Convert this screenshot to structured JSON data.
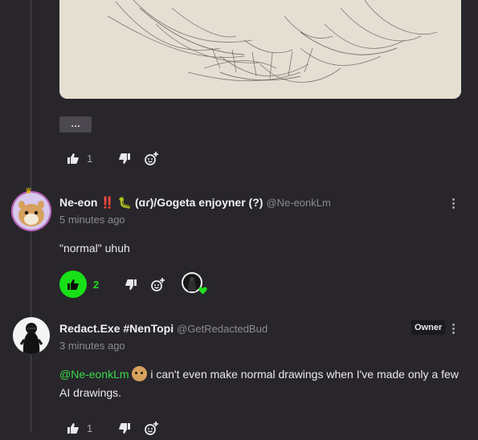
{
  "post": {
    "more_chip": "…",
    "like_count": "1"
  },
  "comments": [
    {
      "name": "Ne-eon ‼️ 🐛 (ɑɾ)/Gogeta enjoyner (?)",
      "handle": "@Ne-eonkLm",
      "time": "5 minutes ago",
      "text": "\"normal\" uhuh",
      "like_count": "2",
      "liked": true
    },
    {
      "name": "Redact.Exe #NenTopi",
      "handle": "@GetRedactedBud",
      "time": "3 minutes ago",
      "badge": "Owner",
      "mention": "@Ne-eonkLm",
      "text": " i can't even make normal drawings when I've made only a few AI drawings.",
      "like_count": "1"
    }
  ],
  "colors": {
    "background": "#28262b",
    "liked": "#17e017",
    "mention": "#39d94a"
  },
  "icons": [
    "thumbs-up-icon",
    "thumbs-down-icon",
    "add-reaction-icon",
    "kebab-menu-icon",
    "crown-icon"
  ]
}
